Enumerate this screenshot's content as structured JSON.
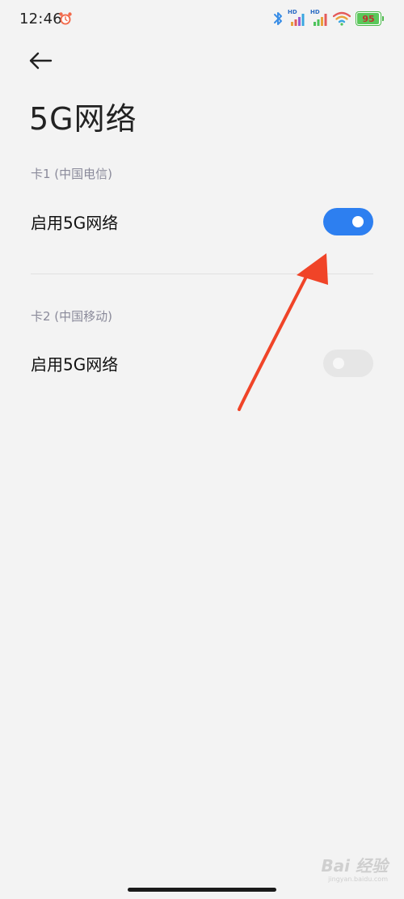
{
  "status_bar": {
    "time": "12:46",
    "hd1": "HD",
    "hd2": "HD",
    "battery_level": "95",
    "battery_value": 95
  },
  "header": {
    "back_label": "←",
    "title": "5G网络"
  },
  "sim1": {
    "section_label": "卡1 (中国电信)",
    "row_label": "启用5G网络",
    "enabled": true
  },
  "sim2": {
    "section_label": "卡2 (中国移动)",
    "row_label": "启用5G网络",
    "enabled": false
  },
  "watermark": {
    "text": "Bai 经验",
    "sub": "jingyan.baidu.com"
  },
  "colors": {
    "toggle_on": "#2d7ff0",
    "toggle_off": "#e6e6e6",
    "arrow": "#f04428",
    "background": "#f3f3f3"
  }
}
